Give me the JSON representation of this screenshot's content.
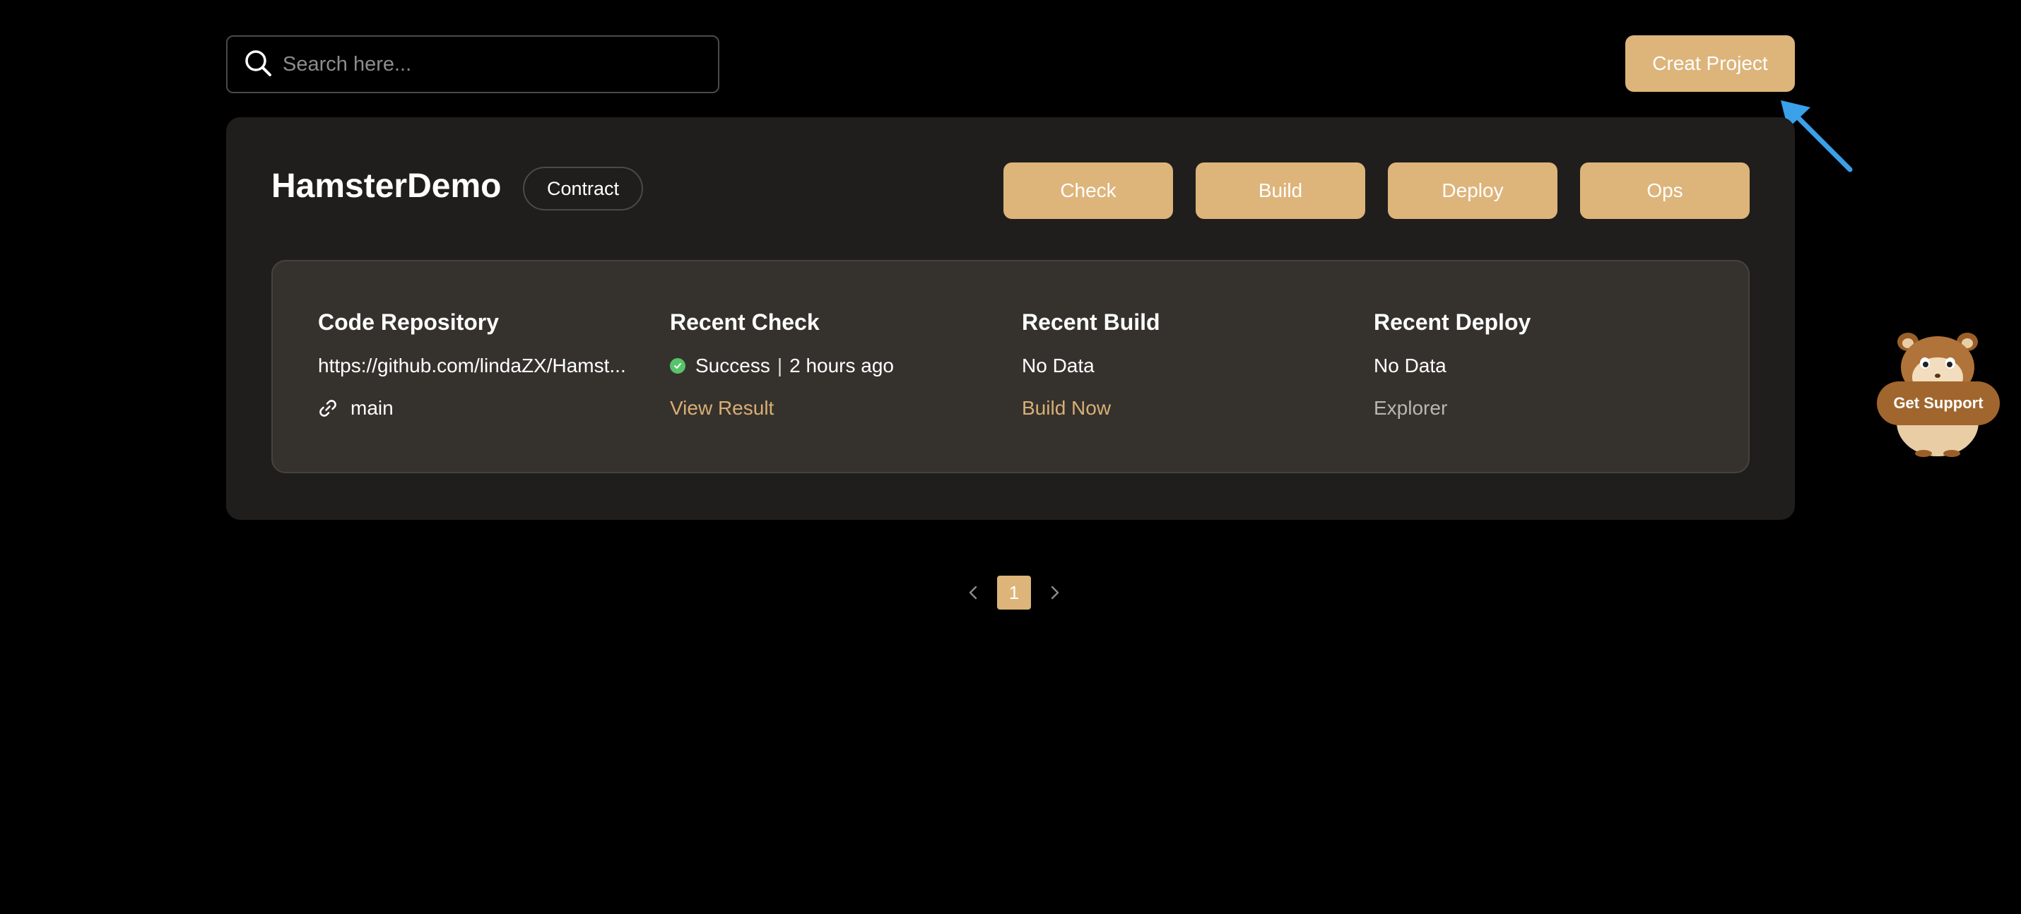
{
  "search": {
    "placeholder": "Search here..."
  },
  "header": {
    "create_label": "Creat Project"
  },
  "project": {
    "name": "HamsterDemo",
    "tag": "Contract",
    "actions": [
      "Check",
      "Build",
      "Deploy",
      "Ops"
    ],
    "columns": {
      "repo": {
        "title": "Code Repository",
        "url": "https://github.com/lindaZX/Hamst...",
        "branch": "main"
      },
      "check": {
        "title": "Recent Check",
        "status": "Success",
        "separator": "|",
        "time": "2 hours ago",
        "link": "View Result"
      },
      "build": {
        "title": "Recent Build",
        "value": "No Data",
        "link": "Build Now"
      },
      "deploy": {
        "title": "Recent Deploy",
        "value": "No Data",
        "link": "Explorer"
      }
    }
  },
  "pagination": {
    "current": "1"
  },
  "support": {
    "label": "Get Support"
  },
  "colors": {
    "accent": "#DDB47A",
    "card_bg": "#1f1e1d",
    "inner_bg": "#35322e",
    "success": "#57c46b",
    "arrow": "#3aa0ea"
  },
  "icons": {
    "search": "search-icon",
    "link": "link-icon",
    "success": "check-circle-icon",
    "prev": "chevron-left-icon",
    "next": "chevron-right-icon",
    "mascot": "hamster-mascot-icon",
    "pointer": "arrow-pointer-icon"
  }
}
